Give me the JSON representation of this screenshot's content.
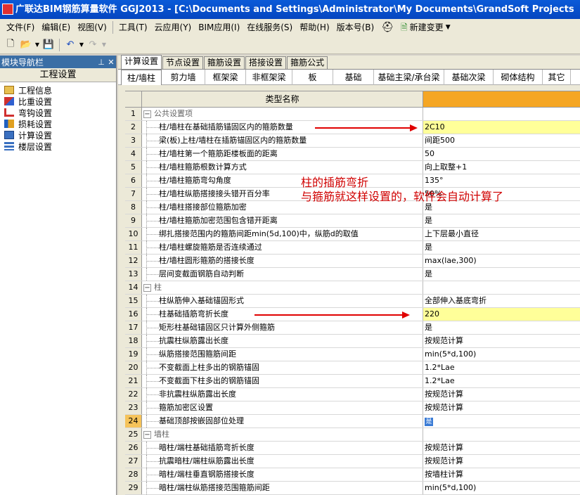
{
  "window": {
    "title": "广联达BIM钢筋算量软件 GGJ2013 - [C:\\Documents and Settings\\Administrator\\My Documents\\GrandSoft Projects"
  },
  "menu": [
    "文件(F)",
    "编辑(E)",
    "视图(V)",
    "工具(T)",
    "云应用(Y)",
    "BIM应用(I)",
    "在线服务(S)",
    "帮助(H)",
    "版本号(B)"
  ],
  "menu_extra": {
    "new_change": "新建变更"
  },
  "toolbar_icons": [
    "new-file-icon",
    "open-folder-icon",
    "save-icon",
    "undo-icon",
    "redo-icon"
  ],
  "left_panel": {
    "header": "模块导航栏",
    "title": "工程设置",
    "items": [
      "工程信息",
      "比重设置",
      "弯钩设置",
      "损耗设置",
      "计算设置",
      "楼层设置"
    ]
  },
  "tabs_primary": [
    "计算设置",
    "节点设置",
    "箍筋设置",
    "搭接设置",
    "箍筋公式"
  ],
  "tabs_secondary": [
    "柱/墙柱",
    "剪力墙",
    "框架梁",
    "非框架梁",
    "板",
    "基础",
    "基础主梁/承台梁",
    "基础次梁",
    "砌体结构",
    "其它"
  ],
  "grid": {
    "header": "类型名称",
    "rows": [
      {
        "n": "1",
        "name": "公共设置项",
        "value": "",
        "group": true
      },
      {
        "n": "2",
        "name": "柱/墙柱在基础插筋锚固区内的箍筋数量",
        "value": "2C10",
        "hl": true
      },
      {
        "n": "3",
        "name": "梁(板)上柱/墙柱在插筋锚固区内的箍筋数量",
        "value": "间距500"
      },
      {
        "n": "4",
        "name": "柱/墙柱第一个箍筋距楼板面的距离",
        "value": "50"
      },
      {
        "n": "5",
        "name": "柱/墙柱箍筋根数计算方式",
        "value": "向上取整+1"
      },
      {
        "n": "6",
        "name": "柱/墙柱箍筋弯勾角度",
        "value": "135°"
      },
      {
        "n": "7",
        "name": "柱/墙柱纵筋搭接接头错开百分率",
        "value": "50%"
      },
      {
        "n": "8",
        "name": "柱/墙柱搭接部位箍筋加密",
        "value": "是"
      },
      {
        "n": "9",
        "name": "柱/墙柱箍筋加密范围包含错开距离",
        "value": "是"
      },
      {
        "n": "10",
        "name": "绑扎搭接范围内的箍筋间距min(5d,100)中，纵筋d的取值",
        "value": "上下层最小直径"
      },
      {
        "n": "11",
        "name": "柱/墙柱螺旋箍筋是否连续通过",
        "value": "是"
      },
      {
        "n": "12",
        "name": "柱/墙柱圆形箍筋的搭接长度",
        "value": "max(lae,300)"
      },
      {
        "n": "13",
        "name": "层间变截面钢筋自动判断",
        "value": "是"
      },
      {
        "n": "14",
        "name": "柱",
        "value": "",
        "group": true
      },
      {
        "n": "15",
        "name": "柱纵筋伸入基础锚固形式",
        "value": "全部伸入基底弯折"
      },
      {
        "n": "16",
        "name": "柱基础插筋弯折长度",
        "value": "220",
        "hl": true
      },
      {
        "n": "17",
        "name": "矩形柱基础锚固区只计算外侧箍筋",
        "value": "是"
      },
      {
        "n": "18",
        "name": "抗震柱纵筋露出长度",
        "value": "按规范计算"
      },
      {
        "n": "19",
        "name": "纵筋搭接范围箍筋间距",
        "value": "min(5*d,100)"
      },
      {
        "n": "20",
        "name": "不变截面上柱多出的钢筋锚固",
        "value": "1.2*Lae"
      },
      {
        "n": "21",
        "name": "不变截面下柱多出的钢筋锚固",
        "value": "1.2*Lae"
      },
      {
        "n": "22",
        "name": "非抗震柱纵筋露出长度",
        "value": "按规范计算"
      },
      {
        "n": "23",
        "name": "箍筋加密区设置",
        "value": "按规范计算"
      },
      {
        "n": "24",
        "name": "基础顶部按嵌固部位处理",
        "value": "是",
        "sel": true,
        "check": true
      },
      {
        "n": "25",
        "name": "墙柱",
        "value": "",
        "group": true
      },
      {
        "n": "26",
        "name": "暗柱/端柱基础插筋弯折长度",
        "value": "按规范计算"
      },
      {
        "n": "27",
        "name": "抗震暗柱/端柱纵筋露出长度",
        "value": "按规范计算"
      },
      {
        "n": "28",
        "name": "暗柱/端柱垂直钢筋搭接长度",
        "value": "按墙柱计算"
      },
      {
        "n": "29",
        "name": "暗柱/端柱纵筋搭接范围箍筋间距",
        "value": "min(5*d,100)"
      }
    ]
  },
  "annotation": {
    "line1": "柱的插筋弯折",
    "line2": "与箍筋就这样设置的，软件会自动计算了",
    "color": "#d00000"
  }
}
